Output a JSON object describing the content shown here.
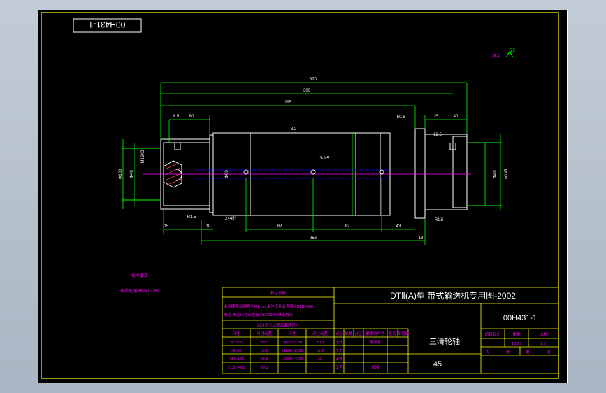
{
  "drawing": {
    "stamp_code": "00H431-1",
    "roughness_note": "其余",
    "roughness_value": "25",
    "dimensions": {
      "overall": "370",
      "length_300": "300",
      "length_295": "295",
      "length_256": "256",
      "left_85": "8.5",
      "left_80": "80",
      "right_25": "25",
      "right_40": "40",
      "step_15": "15",
      "step_10": "10",
      "chamfer": "2×45°",
      "r15_left": "R1.5",
      "r15_right": "R1.5",
      "r15_top": "R1.5",
      "bottom_82a": "82",
      "bottom_82b": "82",
      "bottom_43": "43",
      "right_18": "18",
      "dia_left": "Φ100",
      "dia_left_small": "Φ48",
      "dia_right": "Φ145",
      "dia_right_small": "Φ48",
      "dia_mid": "Φ80",
      "keyway": "M16X2",
      "rough_32": "3.2",
      "rough_125": "12.5",
      "center_mark": "3-Φ5"
    },
    "tech_notes_title": "技术要求",
    "tech_notes_line": "调质处理HB241~269"
  },
  "title_block": {
    "drawing_title": "DTⅡ(A)型  带式输送机专用图-2002",
    "drawing_number": "00H431-1",
    "part_name": "三滑轮轴",
    "material": "45",
    "notes_header": "标注说明",
    "note_line1": "未注圆角及圆角为R1mm 未注形位公差按GB1184-80",
    "note_line2": "未注 未注尺寸公差按GB/T1804-M级执行",
    "tol_header": "未注尺寸公差及偏差尺寸",
    "col_size": "尺寸",
    "col_tol": "尺寸公差",
    "col_size2": "尺寸",
    "col_tol2": "尺寸公差",
    "tol_rows": [
      {
        "a": "≥0.5~6",
        "b": "±0.1",
        "c": ">400~1000",
        "d": "±0.8"
      },
      {
        "a": ">6~30",
        "b": "±0.2",
        "c": ">1000~2000",
        "d": "±1.2"
      },
      {
        "a": ">30~120",
        "b": "±0.3",
        "c": ">2000~4000",
        "d": "±2"
      },
      {
        "a": ">120~400",
        "b": "±0.5",
        "c": "",
        "d": ""
      }
    ],
    "sign_labels": [
      "标记",
      "处数",
      "分区",
      "更改文件号",
      "签名",
      "年月日"
    ],
    "role_design": "设计",
    "role_std": "标准化",
    "role_check": "校对",
    "role_process": "工艺",
    "role_approve": "批准",
    "role_review": "审核",
    "stage_label": "阶段标记",
    "weight_label": "重量",
    "scale_label": "比例",
    "weight_value": "13.07",
    "scale_value": "1:5",
    "sheet_total": "共",
    "sheet_label": "张",
    "sheet_of": "第",
    "sheet_label2": "张"
  },
  "colors": {
    "background": "#000000",
    "outline": "#ffffff",
    "dimension": "#00ff00",
    "frame": "#ffff00",
    "text": "#ff00ff",
    "center": "#0000ff"
  }
}
